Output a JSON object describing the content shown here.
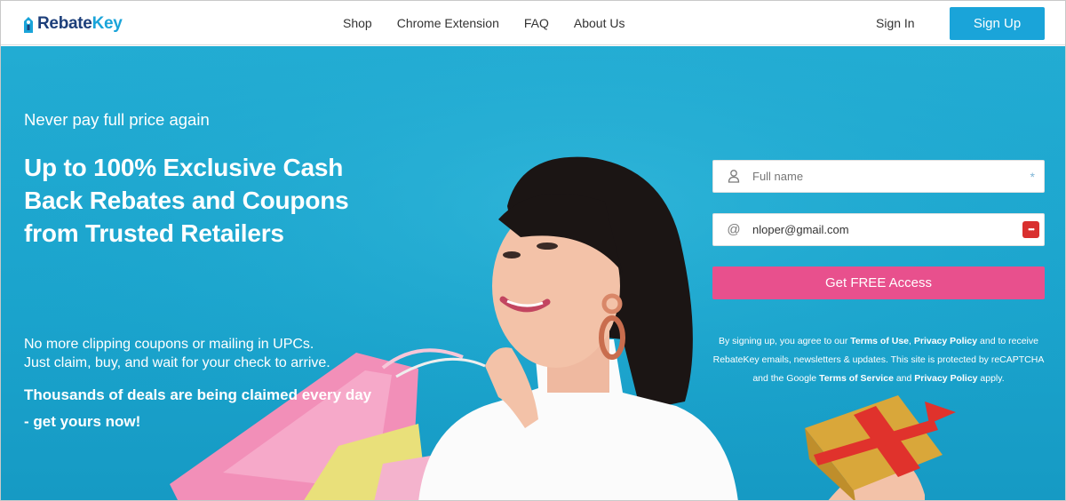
{
  "brand": {
    "name_part1": "Rebate",
    "name_part2": "Key"
  },
  "nav": {
    "items": [
      {
        "label": "Shop"
      },
      {
        "label": "Chrome Extension"
      },
      {
        "label": "FAQ"
      },
      {
        "label": "About Us"
      }
    ],
    "sign_in": "Sign In",
    "sign_up": "Sign Up"
  },
  "hero": {
    "kicker": "Never pay full price again",
    "headline": "Up to 100% Exclusive Cash Back Rebates and Coupons from Trusted Retailers",
    "sub_line1": "No more clipping coupons or mailing in UPCs.",
    "sub_line2": "Just claim, buy, and wait for your check to arrive.",
    "deals": "Thousands of deals are being claimed every day - get yours now!"
  },
  "form": {
    "name_placeholder": "Full name",
    "email_value": "nloper@gmail.com",
    "required_mark": "*",
    "submit_label": "Get FREE Access",
    "legal": {
      "t1": "By signing up, you agree to our ",
      "terms_use": "Terms of Use",
      "t2": ", ",
      "privacy": "Privacy Policy",
      "t3": " and to receive RebateKey emails, newsletters & updates. This site is protected by reCAPTCHA and the Google ",
      "terms_service": "Terms of Service",
      "t4": " and ",
      "privacy2": "Privacy Policy",
      "t5": " apply."
    }
  },
  "icons": {
    "user": "user-icon",
    "at": "at-icon",
    "password_manager": "password-manager-icon"
  },
  "colors": {
    "brand_blue": "#1aa4d9",
    "brand_navy": "#1d3f7a",
    "hero_bg": "#1aa3cc",
    "cta_pink": "#e8508d"
  }
}
